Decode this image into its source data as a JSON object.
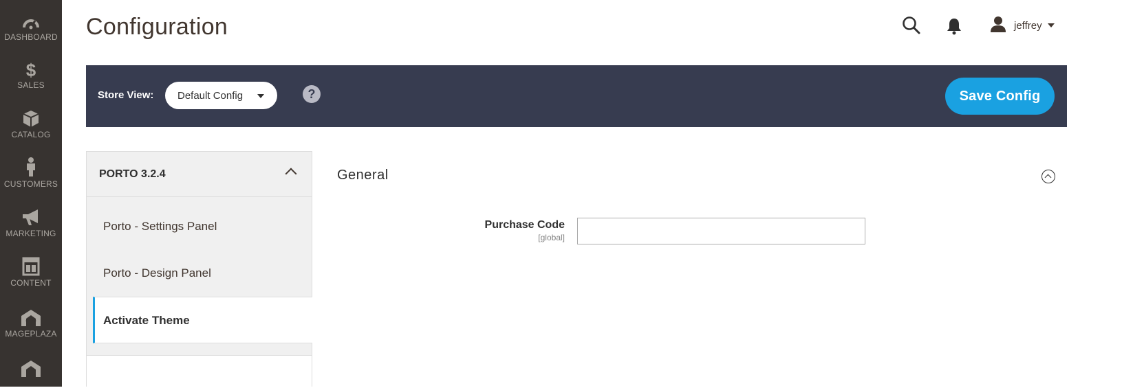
{
  "menu": {
    "items": [
      {
        "label": "DASHBOARD",
        "icon": "dashboard-gauge-icon"
      },
      {
        "label": "SALES",
        "icon": "dollar-icon"
      },
      {
        "label": "CATALOG",
        "icon": "cube-icon"
      },
      {
        "label": "CUSTOMERS",
        "icon": "person-icon"
      },
      {
        "label": "MARKETING",
        "icon": "megaphone-icon"
      },
      {
        "label": "CONTENT",
        "icon": "layout-icon"
      },
      {
        "label": "MAGEPLAZA",
        "icon": "mageplaza-icon"
      }
    ]
  },
  "header": {
    "title": "Configuration",
    "username": "jeffrey",
    "icons": [
      "search-icon",
      "bell-icon",
      "user-icon"
    ]
  },
  "store_bar": {
    "label": "Store View:",
    "selected": "Default Config",
    "help": "?",
    "save_label": "Save Config",
    "colors": {
      "bar": "#373c50",
      "accent": "#1aa1e1"
    }
  },
  "tabs": {
    "group_title": "PORTO 3.2.4",
    "items": [
      {
        "label": "Porto - Settings Panel"
      },
      {
        "label": "Porto - Design Panel"
      },
      {
        "label": "Activate Theme",
        "active": true
      }
    ]
  },
  "section": {
    "title": "General",
    "fields": [
      {
        "label": "Purchase Code",
        "scope": "[global]",
        "value": ""
      }
    ]
  }
}
